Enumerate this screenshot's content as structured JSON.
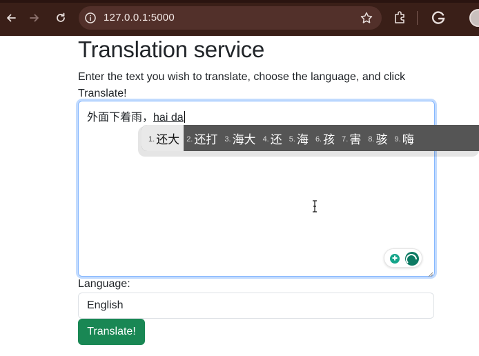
{
  "browser": {
    "url": "127.0.0.1:5000",
    "icons": [
      "back-arrow-icon",
      "forward-arrow-icon",
      "reload-icon",
      "site-info-icon",
      "bookmark-star-icon",
      "extensions-icon",
      "google-icon",
      "profile-avatar"
    ]
  },
  "page": {
    "title": "Translation service",
    "description": "Enter the text you wish to translate, choose the language, and click Translate!"
  },
  "textarea": {
    "text": "外面下着雨，",
    "composition": "hai da"
  },
  "ime": {
    "candidates": [
      {
        "num": "1.",
        "word": "还大"
      },
      {
        "num": "2.",
        "word": "还打"
      },
      {
        "num": "3.",
        "word": "海大"
      },
      {
        "num": "4.",
        "word": "还"
      },
      {
        "num": "5.",
        "word": "海"
      },
      {
        "num": "6.",
        "word": "孩"
      },
      {
        "num": "7.",
        "word": "害"
      },
      {
        "num": "8.",
        "word": "骇"
      },
      {
        "num": "9.",
        "word": "嗨"
      }
    ]
  },
  "form": {
    "language_label": "Language:",
    "language_value": "English",
    "translate_label": "Translate!"
  },
  "colors": {
    "chrome": "#3a1f18",
    "omnibox": "#52302a",
    "focus": "#86b7fe",
    "primary_button": "#198754",
    "ime_bar": "#555555"
  }
}
